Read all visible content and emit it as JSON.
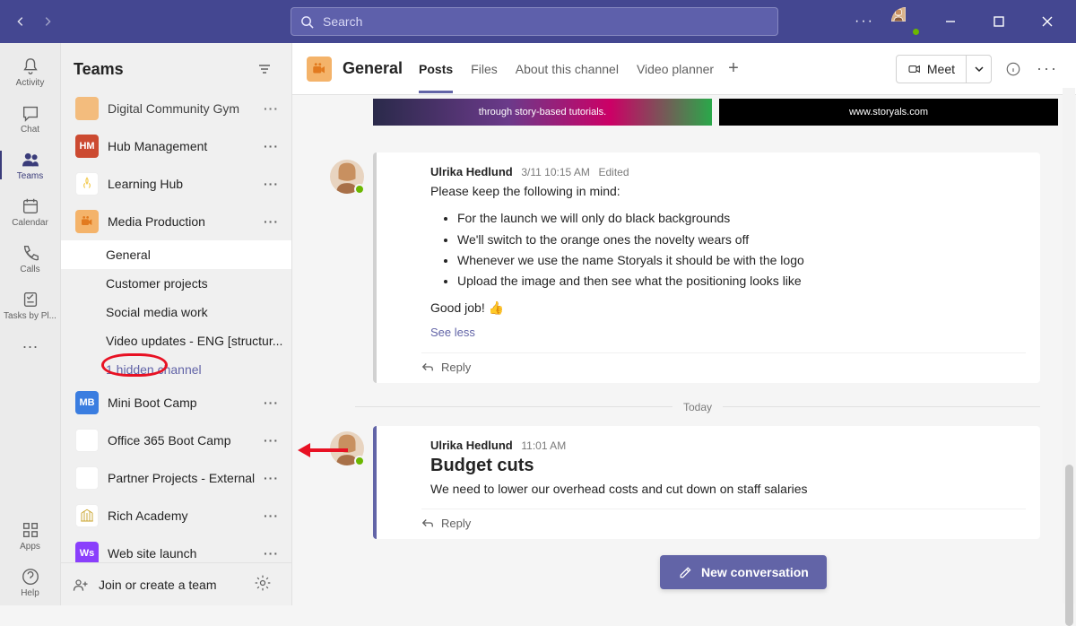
{
  "titlebar": {
    "search_placeholder": "Search"
  },
  "rail": {
    "activity": "Activity",
    "chat": "Chat",
    "teams": "Teams",
    "calendar": "Calendar",
    "calls": "Calls",
    "tasks": "Tasks by Pl...",
    "apps": "Apps",
    "help": "Help"
  },
  "panel": {
    "title": "Teams",
    "teams": [
      {
        "name": "Digital Community Gym",
        "color": "#f4b36a",
        "initials": ""
      },
      {
        "name": "Hub Management",
        "color": "#cc4a31",
        "initials": "HM"
      },
      {
        "name": "Learning Hub",
        "color": "#f4e6b8",
        "initials": ""
      },
      {
        "name": "Media Production",
        "color": "#f4b36a",
        "initials": ""
      },
      {
        "name": "Mini Boot Camp",
        "color": "#3a7de0",
        "initials": "MB"
      },
      {
        "name": "Office 365 Boot Camp",
        "color": "#d9a86c",
        "initials": ""
      },
      {
        "name": "Partner Projects - External",
        "color": "#e8c9a0",
        "initials": ""
      },
      {
        "name": "Rich Academy",
        "color": "#f0e6cc",
        "initials": ""
      },
      {
        "name": "Web site launch",
        "color": "#8a3ffc",
        "initials": "Ws"
      }
    ],
    "media_channels": {
      "general": "General",
      "customer": "Customer projects",
      "social": "Social media work",
      "video": "Video updates - ENG [structur...",
      "hidden": "1 hidden channel"
    },
    "join": "Join or create a team"
  },
  "header": {
    "channel": "General",
    "tabs": {
      "posts": "Posts",
      "files": "Files",
      "about": "About this channel",
      "video": "Video planner"
    },
    "meet": "Meet"
  },
  "banner": {
    "left": "through story-based tutorials.",
    "right": "www.storyals.com"
  },
  "post1": {
    "author": "Ulrika Hedlund",
    "time": "3/11 10:15 AM",
    "edited": "Edited",
    "intro": "Please keep the following in mind:",
    "bullets": [
      "For the launch we will only do black backgrounds",
      "We'll switch to the orange ones the novelty wears off",
      "Whenever we use the name Storyals it should be with the logo",
      "Upload the image and then see what the positioning looks like"
    ],
    "outro": "Good job! 👍",
    "seeless": "See less",
    "reply": "Reply"
  },
  "divider": "Today",
  "post2": {
    "author": "Ulrika Hedlund",
    "time": "11:01 AM",
    "title": "Budget cuts",
    "body": "We need to lower our overhead costs and cut down on staff salaries",
    "reply": "Reply"
  },
  "newconv": "New conversation"
}
